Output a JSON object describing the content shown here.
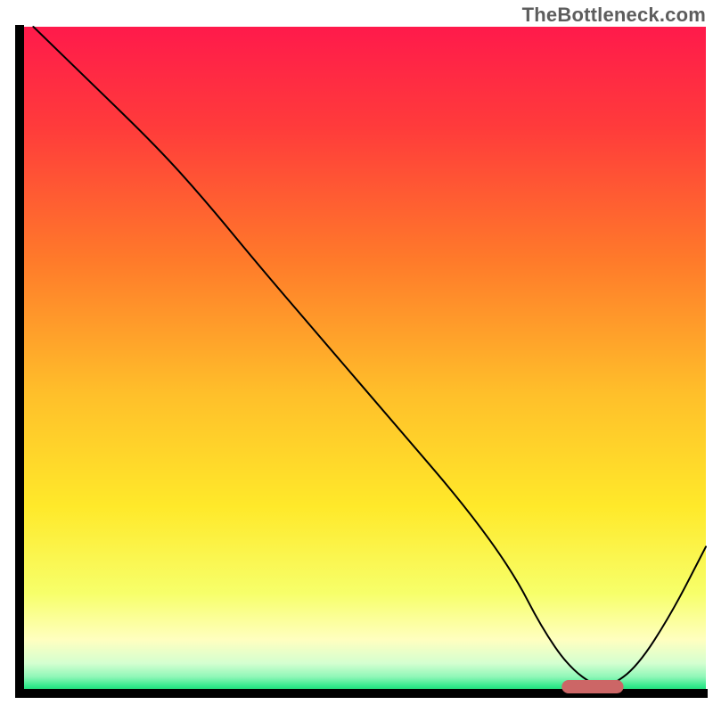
{
  "watermark": "TheBottleneck.com",
  "chart_data": {
    "type": "line",
    "title": "",
    "xlabel": "",
    "ylabel": "",
    "xlim": [
      0,
      100
    ],
    "ylim": [
      0,
      100
    ],
    "grid": false,
    "axes": {
      "left": true,
      "bottom": true,
      "top": false,
      "right": false
    },
    "series": [
      {
        "name": "curve",
        "stroke": "#000000",
        "stroke_width": 2,
        "x": [
          2,
          10,
          20,
          27,
          35,
          45,
          55,
          65,
          72,
          76,
          80,
          84,
          86,
          90,
          95,
          100
        ],
        "y": [
          100,
          92,
          82,
          74,
          64,
          52,
          40,
          28,
          18,
          10,
          4,
          1,
          1,
          4,
          12,
          22
        ]
      }
    ],
    "marker": {
      "name": "optimal-range",
      "shape": "rounded-rect",
      "fill": "#cc6666",
      "x_start": 79,
      "x_end": 88,
      "y": 1,
      "height": 2
    },
    "background_gradient": {
      "direction": "vertical",
      "stops": [
        {
          "pos": 0.0,
          "color": "#ff1a4b"
        },
        {
          "pos": 0.15,
          "color": "#ff3b3b"
        },
        {
          "pos": 0.35,
          "color": "#ff7a2a"
        },
        {
          "pos": 0.55,
          "color": "#ffbf2a"
        },
        {
          "pos": 0.72,
          "color": "#ffe92a"
        },
        {
          "pos": 0.85,
          "color": "#f7ff6a"
        },
        {
          "pos": 0.92,
          "color": "#ffffc0"
        },
        {
          "pos": 0.955,
          "color": "#d4ffd0"
        },
        {
          "pos": 0.975,
          "color": "#90f7b8"
        },
        {
          "pos": 0.99,
          "color": "#2ee88a"
        },
        {
          "pos": 1.0,
          "color": "#18c060"
        }
      ]
    }
  }
}
